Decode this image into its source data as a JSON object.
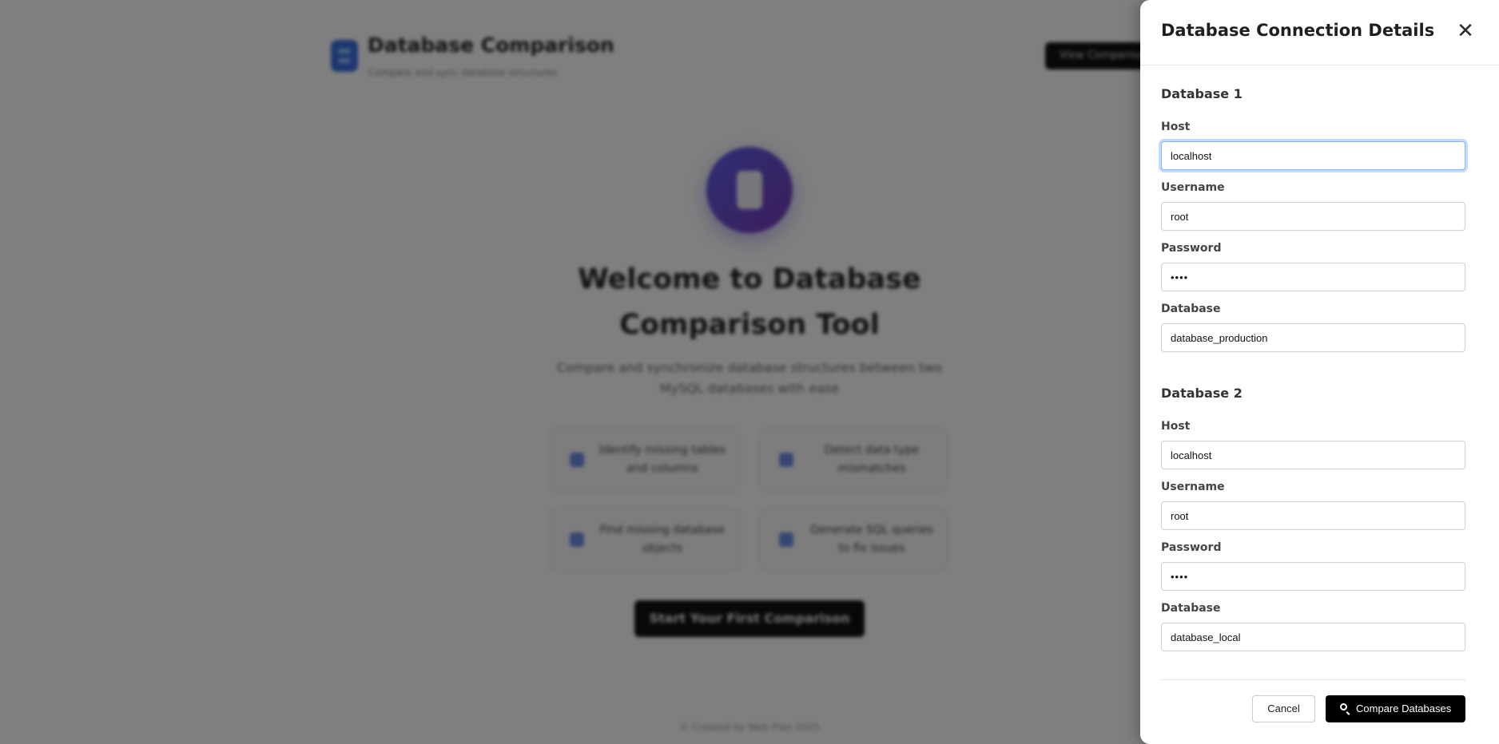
{
  "background": {
    "app_title": "Database Comparison",
    "app_subtitle": "Compare and sync database structures",
    "header_button": "View Comparisons",
    "hero_title": "Welcome to Database Comparison Tool",
    "hero_description": "Compare and synchronize database structures between two MySQL databases with ease",
    "features": [
      {
        "icon": "search-icon",
        "text": "Identify missing tables and columns"
      },
      {
        "icon": "data-type-icon",
        "text": "Detect data type mismatches"
      },
      {
        "icon": "object-icon",
        "text": "Find missing database objects"
      },
      {
        "icon": "code-icon",
        "text": "Generate SQL queries to fix issues"
      }
    ],
    "start_button": "Start Your First Comparison",
    "footer": "© Created by Web Plan 2025"
  },
  "panel": {
    "title": "Database Connection Details",
    "close_symbol": "✕",
    "db1": {
      "section_title": "Database 1",
      "host_label": "Host",
      "host_value": "localhost",
      "username_label": "Username",
      "username_value": "root",
      "password_label": "Password",
      "password_value": "root",
      "database_label": "Database",
      "database_value": "database_production"
    },
    "db2": {
      "section_title": "Database 2",
      "host_label": "Host",
      "host_value": "localhost",
      "username_label": "Username",
      "username_value": "root",
      "password_label": "Password",
      "password_value": "root",
      "database_label": "Database",
      "database_value": "database_local"
    },
    "cancel_label": "Cancel",
    "compare_label": "Compare Databases"
  },
  "colors": {
    "primary_button": "#000000",
    "focus_ring": "#86b7fe",
    "overlay": "rgba(0,0,0,0.5)",
    "hero_gradient_start": "#5a5fe6",
    "hero_gradient_end": "#7a3bb8"
  }
}
